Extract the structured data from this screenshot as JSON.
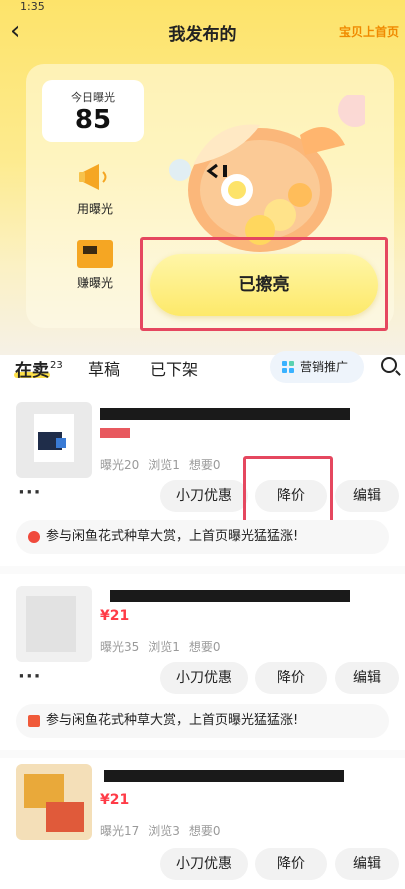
{
  "header": {
    "status_time": "1:35",
    "title": "我发布的",
    "promo_link": "宝贝上首页"
  },
  "exposure": {
    "label": "今日曝光",
    "value": "85"
  },
  "side_actions": [
    {
      "label": "用曝光"
    },
    {
      "label": "赚曝光"
    }
  ],
  "shine_button": "已擦亮",
  "tabs": {
    "selling": "在卖",
    "selling_count": "23",
    "drafts": "草稿",
    "removed": "已下架",
    "marketing": "营销推广"
  },
  "items": [
    {
      "price": "",
      "stats": [
        "曝光20",
        "浏览1",
        "想要0"
      ],
      "actions": [
        "小刀优惠",
        "降价",
        "编辑"
      ],
      "banner": "参与闲鱼花式种草大赏，上首页曝光猛猛涨!"
    },
    {
      "price": "¥21",
      "stats": [
        "曝光35",
        "浏览1",
        "想要0"
      ],
      "actions": [
        "小刀优惠",
        "降价",
        "编辑"
      ],
      "banner": "参与闲鱼花式种草大赏，上首页曝光猛猛涨!"
    },
    {
      "price": "¥21",
      "stats": [
        "曝光17",
        "浏览3",
        "想要0"
      ],
      "actions": [
        "小刀优惠",
        "降价",
        "编辑"
      ]
    }
  ],
  "colors": {
    "accent": "#fde14a",
    "price": "#ff3b47",
    "highlight": "#e5475f",
    "promo": "#f08a00"
  }
}
